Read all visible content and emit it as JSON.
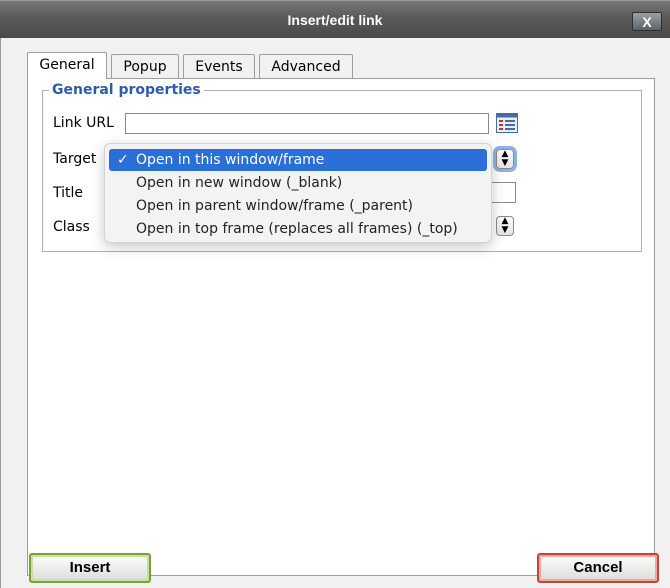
{
  "dialog": {
    "title": "Insert/edit link",
    "close_label": "X"
  },
  "tabs": [
    {
      "label": "General",
      "active": true
    },
    {
      "label": "Popup",
      "active": false
    },
    {
      "label": "Events",
      "active": false
    },
    {
      "label": "Advanced",
      "active": false
    }
  ],
  "general": {
    "legend": "General properties",
    "link_url_label": "Link URL",
    "link_url_value": "",
    "target_label": "Target",
    "title_label": "Title",
    "title_value": "",
    "class_label": "Class"
  },
  "target_dropdown": {
    "options": [
      {
        "label": "Open in this window/frame",
        "selected": true
      },
      {
        "label": "Open in new window (_blank)",
        "selected": false
      },
      {
        "label": "Open in parent window/frame (_parent)",
        "selected": false
      },
      {
        "label": "Open in top frame (replaces all frames) (_top)",
        "selected": false
      }
    ],
    "check_mark": "✓"
  },
  "buttons": {
    "insert": "Insert",
    "cancel": "Cancel"
  },
  "colors": {
    "accent": "#2a6fd8",
    "legend": "#2d5caa",
    "insert_border": "#7aa138",
    "cancel_border": "#c0473a"
  },
  "icons": {
    "browse": "browse-list-icon",
    "close": "close-icon",
    "select_arrows": "updown-arrows-icon"
  }
}
